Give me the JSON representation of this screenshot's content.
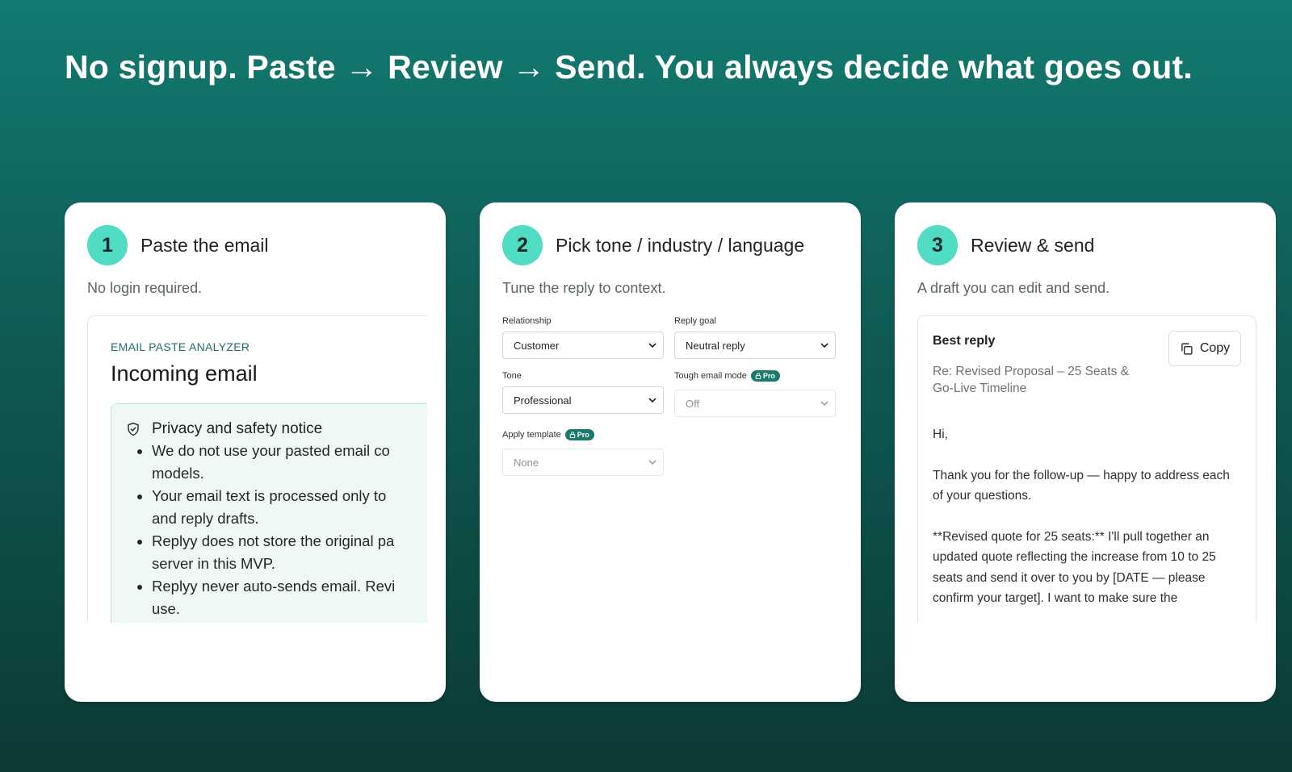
{
  "headline": "No signup. Paste → Review → Send. You always decide what goes out.",
  "steps": [
    {
      "number": "1",
      "title": "Paste the email",
      "subtitle": "No login required."
    },
    {
      "number": "2",
      "title": "Pick tone / industry / language",
      "subtitle": "Tune the reply to context."
    },
    {
      "number": "3",
      "title": "Review & send",
      "subtitle": "A draft you can edit and send."
    }
  ],
  "paste": {
    "kicker": "EMAIL PASTE ANALYZER",
    "title": "Incoming email",
    "notice_title": "Privacy and safety notice",
    "bullets": [
      {
        "line1": "We do not use your pasted email co",
        "line2": "models."
      },
      {
        "line1": "Your email text is processed only to",
        "line2": "and reply drafts."
      },
      {
        "line1": "Replyy does not store the original pa",
        "line2": "server in this MVP."
      },
      {
        "line1": "Replyy never auto-sends email. Revi",
        "line2": "use."
      }
    ]
  },
  "options": {
    "relationship": {
      "label": "Relationship",
      "value": "Customer"
    },
    "reply_goal": {
      "label": "Reply goal",
      "value": "Neutral reply"
    },
    "tone": {
      "label": "Tone",
      "value": "Professional"
    },
    "tough_mode": {
      "label": "Tough email mode",
      "badge": "Pro",
      "value": "Off"
    },
    "template": {
      "label": "Apply template",
      "badge": "Pro",
      "value": "None"
    }
  },
  "review": {
    "best_label": "Best reply",
    "copy_label": "Copy",
    "subject": "Re: Revised Proposal – 25 Seats & Go-Live Timeline",
    "paragraphs": [
      "Hi,",
      "Thank you for the follow-up — happy to address each of your questions.",
      "**Revised quote for 25 seats:** I'll pull together an updated quote reflecting the increase from 10 to 25 seats and send it over to you by [DATE — please confirm your target]. I want to make sure the"
    ]
  },
  "colors": {
    "accent": "#4fdcc3",
    "pro_badge": "#1a7a6b",
    "background": "#127a70"
  }
}
